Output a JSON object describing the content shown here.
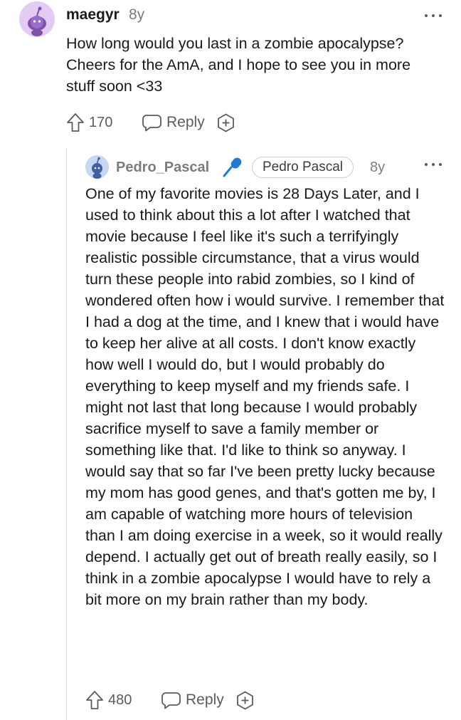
{
  "comments": [
    {
      "username": "maegyr",
      "age": "8y",
      "text": "How long would you last in a zombie apocalypse? Cheers for the AmA, and I hope to see you in more stuff soon <33",
      "score": "170",
      "reply_label": "Reply"
    },
    {
      "username": "Pedro_Pascal",
      "flair": "Pedro Pascal",
      "age": "8y",
      "text": "One of my favorite movies is 28 Days Later, and I used to think about this a lot after I watched that movie because I feel like it's such a terrifyingly realistic possible circumstance, that a virus would turn these people into rabid zombies, so I kind of wondered often how i would survive. I remember that I had a dog at the time, and I knew that i would have to keep her alive at all costs. I don't know exactly how well I would do, but I would probably do everything to keep myself and my friends safe. I might not last that long because I would probably sacrifice myself to save a family member or something like that. I'd like to think so anyway. I would say that so far I've been pretty lucky because my mom has good genes, and that's gotten me by, I am capable of watching more hours of television than I am doing exercise in a week, so it would really depend. I actually get out of breath really easily, so I think in a zombie apocalypse I would have to rely a bit more on my brain rather than my body.",
      "score": "480",
      "reply_label": "Reply"
    }
  ],
  "icons": {
    "avatar": "snoo-avatar-icon",
    "verified": "microphone-icon",
    "more": "more-dots-icon",
    "upvote": "upvote-arrow-icon",
    "reply": "speech-bubble-icon",
    "award": "award-plus-icon"
  },
  "colors": {
    "avatar_top": "#e3cbf3",
    "avatar_reply": "#c7d6f4",
    "mic_accent": "#1f7ad6",
    "muted_text": "#7c7c7c"
  }
}
